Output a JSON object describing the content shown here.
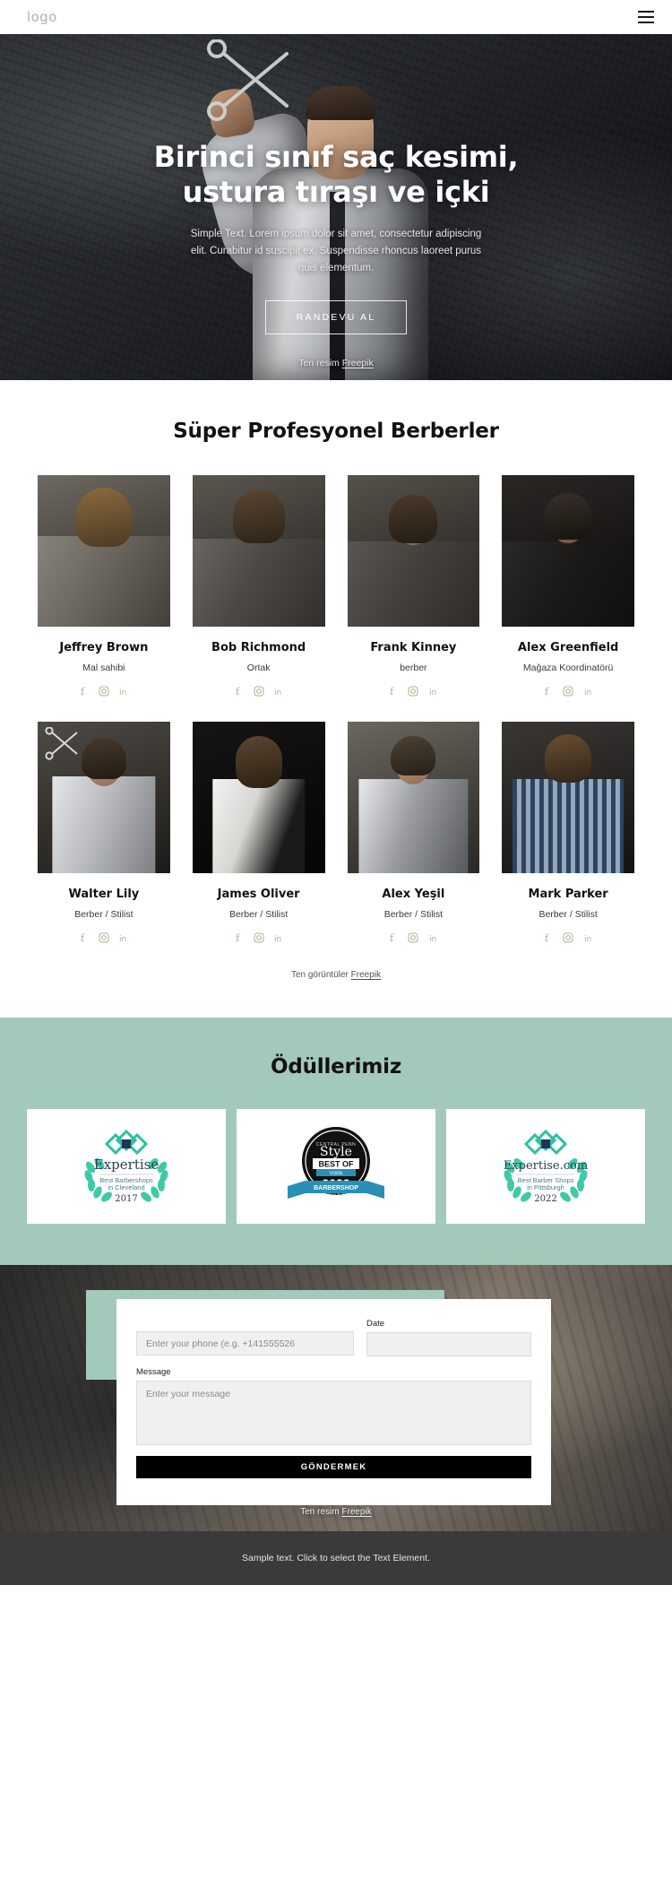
{
  "header": {
    "logo": "logo",
    "menu_icon": "hamburger-menu-icon"
  },
  "hero": {
    "title": "Birinci sınıf saç kesimi, ustura tıraşı ve içki",
    "subtitle": "Simple Text. Lorem ipsum dolor sit amet, consectetur adipiscing elit. Curabitur id suscipit ex. Suspendisse rhoncus laoreet purus quis elementum.",
    "button": "RANDEVU AL",
    "credit_prefix": "Ten resim ",
    "credit_link": "Freepik"
  },
  "team": {
    "title": "Süper Profesyonel Berberler",
    "credit_prefix": "Ten görüntüler ",
    "credit_link": "Freepik",
    "social_icons": [
      "facebook-icon",
      "instagram-icon",
      "linkedin-icon"
    ],
    "members": [
      {
        "name": "Jeffrey Brown",
        "role": "Mal sahibi"
      },
      {
        "name": "Bob Richmond",
        "role": "Ortak"
      },
      {
        "name": "Frank Kinney",
        "role": "berber"
      },
      {
        "name": "Alex Greenfield",
        "role": "Mağaza Koordinatörü"
      },
      {
        "name": "Walter Lily",
        "role": "Berber / Stilist"
      },
      {
        "name": "James Oliver",
        "role": "Berber / Stilist"
      },
      {
        "name": "Alex Yeşil",
        "role": "Berber / Stilist"
      },
      {
        "name": "Mark Parker",
        "role": "Berber / Stilist"
      }
    ]
  },
  "awards": {
    "title": "Ödüllerimiz",
    "items": [
      {
        "brand": "Expertise",
        "line1": "Best Barbershops",
        "line2": "in Cleveland",
        "year": "2017",
        "style": "laurel"
      },
      {
        "brand": "Style",
        "line1": "BEST OF",
        "line2": "YORK",
        "year": "2022",
        "style": "seal",
        "ribbon": "BARBERSHOP",
        "ribbon_sub": "Cornerstone Barbershop"
      },
      {
        "brand": "Expertise.com",
        "line1": "Best Barber Shops",
        "line2": "in Pittsburgh",
        "year": "2022",
        "style": "laurel"
      }
    ]
  },
  "contact": {
    "phone_placeholder": "Enter your phone (e.g. +141555526",
    "date_label": "Date",
    "date_value": "",
    "message_label": "Message",
    "message_placeholder": "Enter your message",
    "submit": "GÖNDERMEK",
    "credit_prefix": "Ten resim ",
    "credit_link": "Freepik"
  },
  "footer": {
    "text": "Sample text. Click to select the Text Element."
  },
  "colors": {
    "mint": "#a3c9ba",
    "social": "#b5ad8e",
    "dark": "#000000",
    "footer": "#3a3a3a"
  }
}
